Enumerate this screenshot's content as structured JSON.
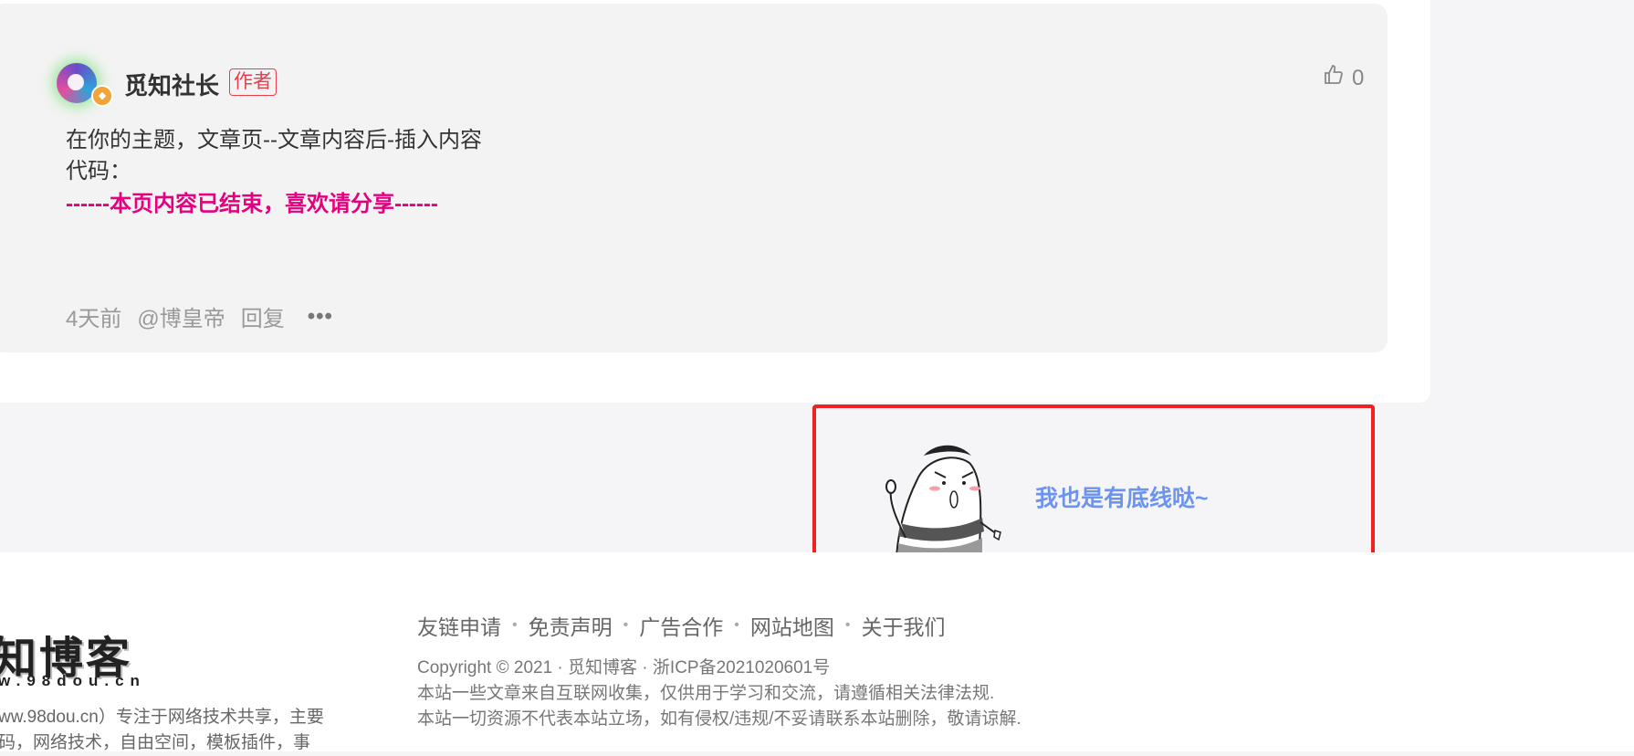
{
  "comment": {
    "username": "觅知社长",
    "badge": "作者",
    "likes": "0",
    "lines": [
      "在你的主题，文章页--文章内容后-插入内容",
      "代码："
    ],
    "highlight": "------本页内容已结束，喜欢请分享------",
    "time": "4天前",
    "mention": "@博皇帝",
    "reply": "回复",
    "more": "•••"
  },
  "banner": {
    "text": "我也是有底线哒~"
  },
  "footer": {
    "logo_text": "知博客",
    "logo_url": "w.98dou.cn",
    "about": [
      "ww.98dou.cn）专注于网络技术共享，主要",
      "码，网络技术，自由空间，模板插件，事"
    ],
    "links": [
      "友链申请",
      "免责声明",
      "广告合作",
      "网站地图",
      "关于我们"
    ],
    "info": [
      "Copyright © 2021 · 觅知博客 · 浙ICP备2021020601号",
      "本站一些文章来自互联网收集，仅供用于学习和交流，请遵循相关法律法规.",
      "本站一切资源不代表本站立场，如有侵权/违规/不妥请联系本站删除，敬请谅解."
    ]
  },
  "colors": {
    "accent_pink": "#e5007f",
    "banner_text": "#6c93f0",
    "banner_border": "#ee2222"
  }
}
